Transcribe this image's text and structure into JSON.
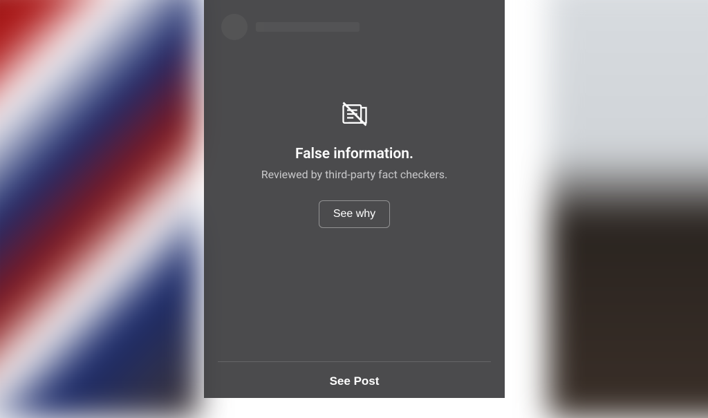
{
  "warning": {
    "title": "False information.",
    "subtitle": "Reviewed by third-party fact checkers.",
    "see_why_label": "See why",
    "see_post_label": "See Post"
  }
}
